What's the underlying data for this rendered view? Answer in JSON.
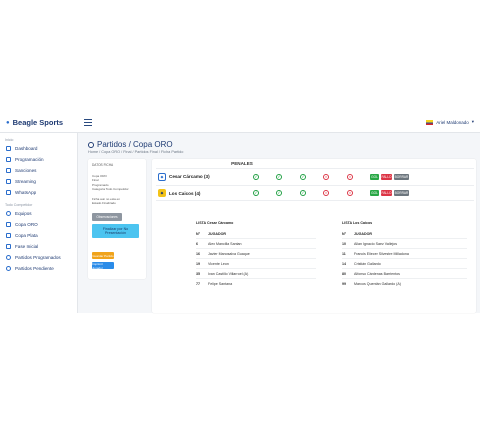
{
  "topbar": {
    "brand": "Beagle Sports",
    "user": "Ariel Maldonado"
  },
  "sidebar": {
    "section1": "Inicio",
    "items1": [
      {
        "label": "Dashboard",
        "icon": "dashboard-icon"
      },
      {
        "label": "Programación",
        "icon": "calendar-icon"
      },
      {
        "label": "Sanciones",
        "icon": "calendar-icon"
      },
      {
        "label": "Streaming",
        "icon": "calendar-icon"
      },
      {
        "label": "WhatsApp",
        "icon": "calendar-icon"
      }
    ],
    "section2": "Todo Competidor",
    "items2": [
      {
        "label": "Equipos",
        "icon": "users-icon"
      },
      {
        "label": "Copa ORO",
        "icon": "trophy-icon"
      },
      {
        "label": "Copa Plata",
        "icon": "trophy-icon"
      },
      {
        "label": "Fase Inicial",
        "icon": "trophy-icon"
      },
      {
        "label": "Partidos Programados",
        "icon": "soccer-icon"
      },
      {
        "label": "Partidos Pendiente",
        "icon": "soccer-icon"
      }
    ]
  },
  "page": {
    "title": "Partidos / Copa ORO",
    "breadcrumb": "Home / Copa ORO / Final / Partidos Final / Ficha Partido"
  },
  "left_card": {
    "title": "DATOS FICHA",
    "lines_a": [
      "Copa ORO",
      "Final",
      "Programado",
      "Categoria Todo Competidor"
    ],
    "lines_b": [
      "Ficha aun no esta en",
      "Estado Finalizado"
    ],
    "btn_gray": "Observaciones",
    "btn_blue_line1": "Finalizar por No",
    "btn_blue_line2": "Presentación",
    "btn_orange": "Guardar Partido",
    "btn_blue2": "Imprimir Jugador"
  },
  "penales": {
    "title": "PENALES",
    "teams": [
      {
        "name": "Cesar Cárcamo (3)",
        "badge": "shield-icon",
        "results": [
          "ok",
          "ok",
          "ok",
          "no",
          "no"
        ]
      },
      {
        "name": "Los Caicos (4)",
        "badge": "shield-icon",
        "results": [
          "ok",
          "ok",
          "ok",
          "no",
          "no"
        ]
      }
    ],
    "buttons": {
      "gol": "GOL",
      "fallo": "FALLO",
      "borrar": "BORRAR"
    }
  },
  "listas": [
    {
      "title": "LISTA Cesar Cárcamo",
      "header": {
        "num": "N°",
        "player": "JUGADOR"
      },
      "rows": [
        {
          "num": "6",
          "name": "Alex Mancilla Santan"
        },
        {
          "num": "16",
          "name": "Javier Manosalva Guaque"
        },
        {
          "num": "19",
          "name": "Vicente Leon"
        },
        {
          "num": "35",
          "name": "Ivan Castillo Villarroel (A)"
        },
        {
          "num": "77",
          "name": "Felipe Santana"
        }
      ]
    },
    {
      "title": "LISTA Los Caicos",
      "header": {
        "num": "N°",
        "player": "JUGADOR"
      },
      "rows": [
        {
          "num": "10",
          "name": "Allan Ignacio Saez Vallejos"
        },
        {
          "num": "11",
          "name": "Francis Eliecer Silvestre Milladona"
        },
        {
          "num": "14",
          "name": "Cristián Gallardo"
        },
        {
          "num": "80",
          "name": "Alfonso Cárdenas Barrientos"
        },
        {
          "num": "99",
          "name": "Marcos Quentán Gallardo (A)"
        }
      ]
    }
  ]
}
